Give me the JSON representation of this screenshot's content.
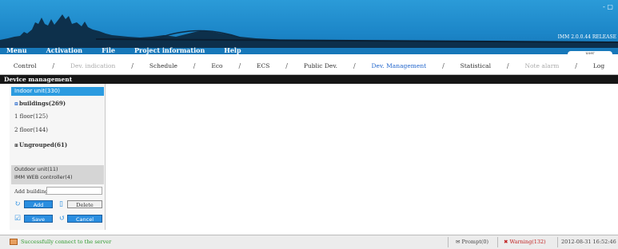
{
  "window": {
    "controls": "- ▢",
    "version": "IMM 2.0.0.44 RELEASE"
  },
  "menu": [
    "Menu",
    "Activation",
    "File",
    "Project information",
    "Help"
  ],
  "user_tab": "user",
  "tabs": [
    {
      "label": "Control",
      "state": "normal"
    },
    {
      "label": "Dev. indication",
      "state": "disabled"
    },
    {
      "label": "Schedule",
      "state": "normal"
    },
    {
      "label": "Eco",
      "state": "normal"
    },
    {
      "label": "ECS",
      "state": "normal"
    },
    {
      "label": "Public Dev.",
      "state": "normal"
    },
    {
      "label": "Dev. Management",
      "state": "active"
    },
    {
      "label": "Statistical",
      "state": "normal"
    },
    {
      "label": "Note alarm",
      "state": "disabled"
    },
    {
      "label": "Log",
      "state": "normal"
    }
  ],
  "panel": {
    "title": "Device management",
    "indoor": "Indoor unit(330)",
    "buildings": "buildings(269)",
    "floor1": "1 floor(125)",
    "floor2": "2 floor(144)",
    "ungrouped": "Ungrouped(61)",
    "outdoor": "Outdoor unit(11)",
    "web_controller": "IMM WEB controller(4)",
    "add_buildings_label": "Add buildings",
    "add_buildings_value": "",
    "add_btn": "Add",
    "delete_btn": "Delete",
    "save_btn": "Save",
    "cancel_btn": "Cancel"
  },
  "status": {
    "message": "Successfully connect to the server",
    "prompt": "Prompt(0)",
    "warning": "Warning(132)",
    "datetime": "2012-08-31 16:52:46"
  },
  "colors": {
    "header": "#1c86c8",
    "selected": "#2b9be0",
    "active_tab": "#2266cc",
    "warning": "#c02020",
    "success": "#2e9a2e"
  }
}
